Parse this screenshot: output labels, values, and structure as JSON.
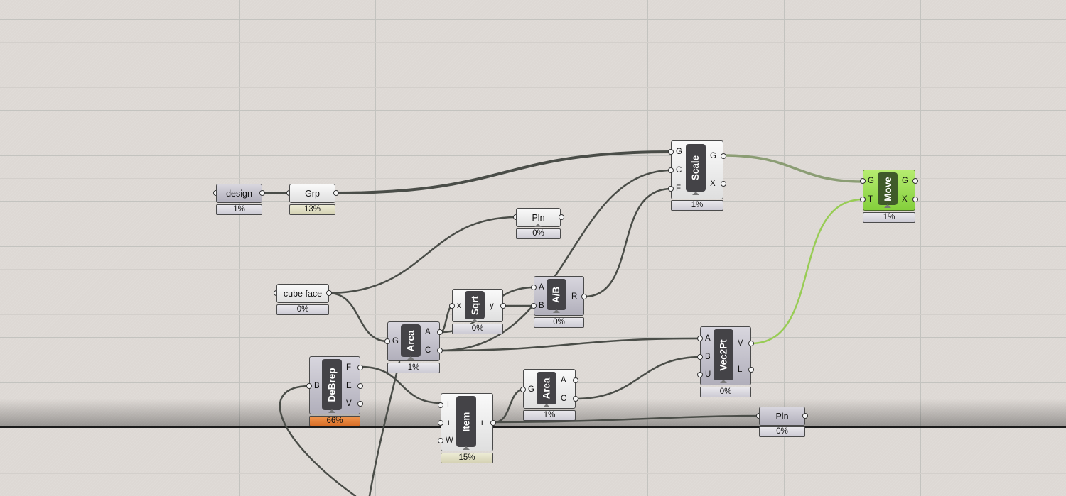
{
  "canvas": {
    "colors": {
      "background": "#ddd8d4",
      "wire": "#4a4d48",
      "selected_wire": "#98cc55",
      "selected_component": "#9ada52",
      "warning_bar": "#e07a33"
    }
  },
  "components": {
    "design": {
      "label": "design",
      "status": "1%"
    },
    "grp": {
      "label": "Grp",
      "status": "13%"
    },
    "pln_top": {
      "label": "Pln",
      "status": "0%"
    },
    "cube_face": {
      "label": "cube face",
      "status": "0%"
    },
    "scale": {
      "title": "Scale",
      "status": "1%",
      "inputs": [
        "G",
        "C",
        "F"
      ],
      "outputs": [
        "G",
        "X"
      ]
    },
    "move": {
      "title": "Move",
      "status": "1%",
      "inputs": [
        "G",
        "T"
      ],
      "outputs": [
        "G",
        "X"
      ]
    },
    "sqrt": {
      "title": "Sqrt",
      "status": "0%",
      "inputs": [
        "x"
      ],
      "outputs": [
        "y"
      ]
    },
    "div": {
      "title": "A/B",
      "status": "0%",
      "inputs": [
        "A",
        "B"
      ],
      "outputs": [
        "R"
      ]
    },
    "area1": {
      "title": "Area",
      "status": "1%",
      "inputs": [
        "G"
      ],
      "outputs": [
        "A",
        "C"
      ]
    },
    "vec2pt": {
      "title": "Vec2Pt",
      "status": "0%",
      "inputs": [
        "A",
        "B",
        "U"
      ],
      "outputs": [
        "V",
        "L"
      ]
    },
    "debrep": {
      "title": "DeBrep",
      "status": "66%",
      "inputs": [
        "B"
      ],
      "outputs": [
        "F",
        "E",
        "V"
      ]
    },
    "area2": {
      "title": "Area",
      "status": "1%",
      "inputs": [
        "G"
      ],
      "outputs": [
        "A",
        "C"
      ]
    },
    "item": {
      "title": "Item",
      "status": "15%",
      "inputs": [
        "L",
        "i",
        "W"
      ],
      "outputs": [
        "i"
      ]
    },
    "pln_bottom": {
      "label": "Pln",
      "status": "0%"
    }
  }
}
